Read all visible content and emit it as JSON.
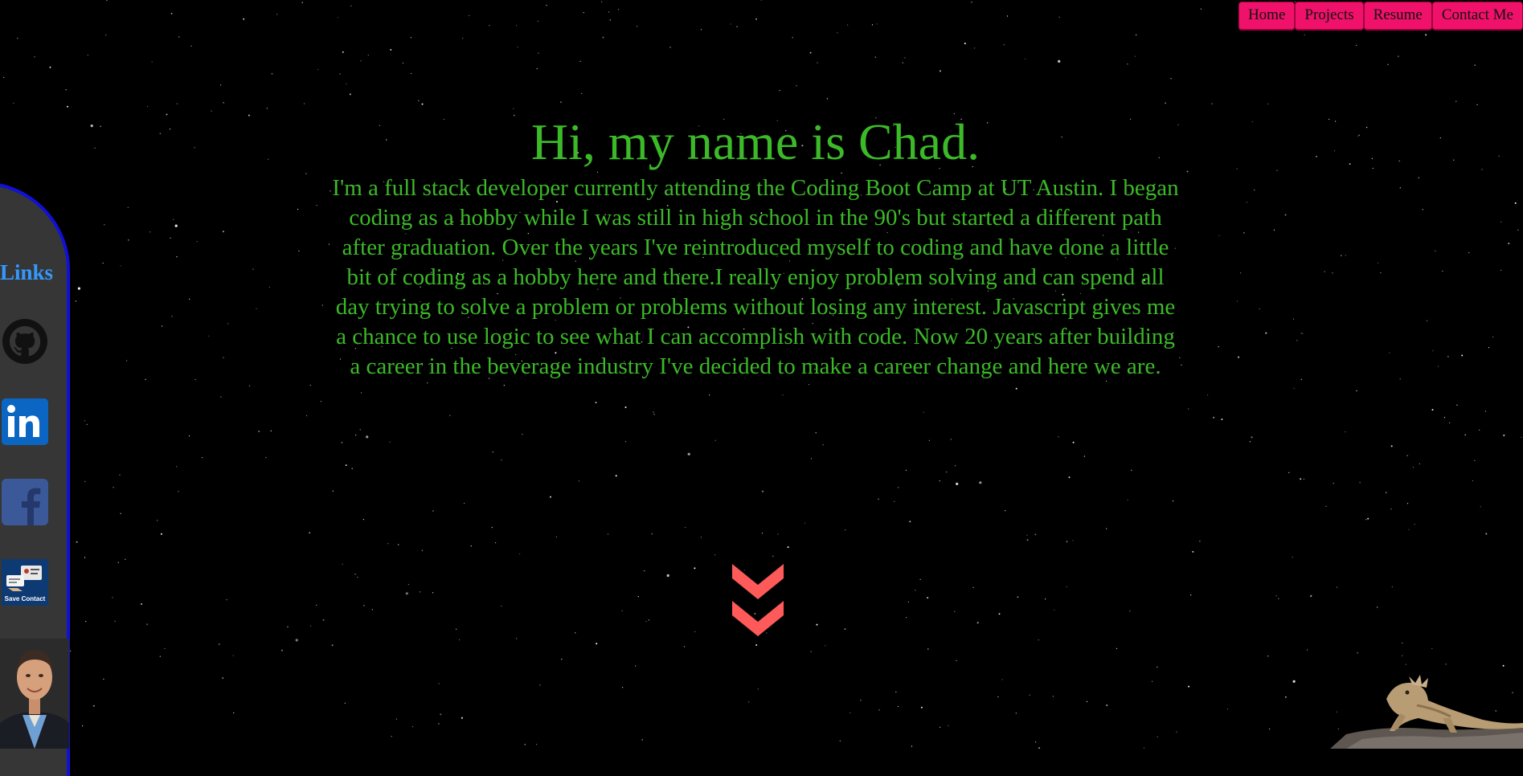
{
  "nav": {
    "items": [
      {
        "label": "Home"
      },
      {
        "label": "Projects"
      },
      {
        "label": "Resume"
      },
      {
        "label": "Contact Me"
      }
    ]
  },
  "hero": {
    "heading": "Hi, my name is Chad.",
    "bio": "I'm a full stack developer currently attending the Coding Boot Camp at UT Austin. I began coding as a hobby while I was still in high school in the 90's but started a different path after graduation. Over the years I've reintroduced myself to coding and have done a little bit of coding as a hobby here and there.I really enjoy problem solving and can spend all day trying to solve a problem or problems without losing any interest. Javascript gives me a chance to use logic to see what I can accomplish with code. Now 20 years after building a career in the beverage industry I've decided to make a career change and here we are."
  },
  "sidebar": {
    "title": "Links",
    "icons": [
      {
        "name": "github-icon"
      },
      {
        "name": "linkedin-icon"
      },
      {
        "name": "facebook-icon"
      },
      {
        "name": "save-contact-icon",
        "label": "Save Contact"
      }
    ]
  },
  "colors": {
    "background": "#000000",
    "nav_button": "#f0116b",
    "hero_text": "#3cb928",
    "links_title": "#3399ff",
    "sidebar_bg": "#363636",
    "sidebar_border": "#1010d8",
    "chevron": "#ff5a5a"
  }
}
